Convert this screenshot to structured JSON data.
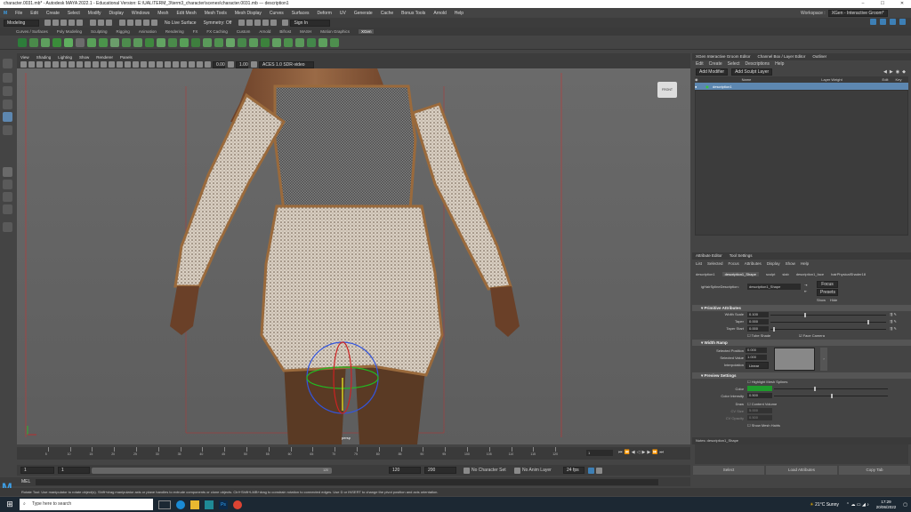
{
  "window": {
    "title": "character.0031.mb* - Autodesk MAYA 2022.1 - Educational Version: E:\\UAL\\TERM_3\\term3_character\\scenes\\character.0031.mb --- description1",
    "workspace_label": "Workspace :",
    "workspace_value": "XGen - Interactive Groom*"
  },
  "menus": [
    "File",
    "Edit",
    "Create",
    "Select",
    "Modify",
    "Display",
    "Windows",
    "Mesh",
    "Edit Mesh",
    "Mesh Tools",
    "Mesh Display",
    "Curves",
    "Surfaces",
    "Deform",
    "UV",
    "Generate",
    "Cache",
    "Bonus Tools",
    "Arnold",
    "Help"
  ],
  "status_line": {
    "mode": "Modeling",
    "live_surface": "No Live Surface",
    "symmetry": "Symmetry: Off",
    "sign_in": "Sign In"
  },
  "shelf_tabs": [
    "Curves / Surfaces",
    "Poly Modeling",
    "Sculpting",
    "Rigging",
    "Animation",
    "Rendering",
    "FX",
    "FX Caching",
    "Custom",
    "Arnold",
    "Bifrost",
    "MASH",
    "Motion Graphics",
    "XGen"
  ],
  "shelf_active": "XGen",
  "viewport": {
    "menus": [
      "View",
      "Shading",
      "Lighting",
      "Show",
      "Renderer",
      "Panels"
    ],
    "exposure": "0.00",
    "gamma": "1.00",
    "color_space": "ACES 1.0 SDR-video (sRGB)",
    "camera_label": "persp",
    "viewcube_label": "FRONT"
  },
  "timeline": {
    "ticks": [
      "5",
      "10",
      "15",
      "20",
      "25",
      "30",
      "35",
      "40",
      "45",
      "50",
      "55",
      "60",
      "65",
      "70",
      "75",
      "80",
      "85",
      "90",
      "95",
      "100",
      "105",
      "110",
      "115",
      "120"
    ],
    "current_frame": "1"
  },
  "range": {
    "start": "1",
    "inner_start": "1",
    "slider_value": "120",
    "inner_end": "120",
    "end": "200",
    "character_set": "No Character Set",
    "anim_layer": "No Anim Layer",
    "fps": "24 fps"
  },
  "mel": {
    "label": "MEL"
  },
  "help_line": "Rotate Tool: Use manipulator to rotate object(s). Shift+drag manipulator axis or plane handles to extrude components or clone objects. Ctrl+Shift+LMB+drag to constrain rotation to connected edges. Use D or INSERT to change the pivot position and axis orientation.",
  "xgen": {
    "tabs": [
      "XGen Interactive Groom Editor",
      "Channel Box / Layer Editor",
      "Outliner"
    ],
    "menus": [
      "Edit",
      "Create",
      "Select",
      "Descriptions",
      "Help"
    ],
    "buttons": [
      "Add Modifier",
      "Add Sculpt Layer"
    ],
    "columns": [
      "Name",
      "Layer Weight",
      "Edit",
      "Key"
    ],
    "rows": [
      {
        "name": "description1"
      }
    ]
  },
  "attr": {
    "tabs": [
      "Attribute Editor",
      "Tool Settings"
    ],
    "menus": [
      "List",
      "Selected",
      "Focus",
      "Attributes",
      "Display",
      "Show",
      "Help"
    ],
    "node_tabs": [
      "description1",
      "description1_Shape",
      "sculpt",
      "slab",
      "description1_face",
      "hairPhysicalShader18"
    ],
    "node_label": "igHairSplineDescription:",
    "node_value": "description1_Shape",
    "focus": "Focus",
    "presets": "Presets",
    "show": "Show",
    "hide": "Hide",
    "sections": {
      "primitive": "Primitive Attributes",
      "width_ramp": "Width Ramp",
      "preview": "Preview Settings"
    },
    "primitive": [
      {
        "label": "Width Scale",
        "value": "0.100",
        "frac": 0.3
      },
      {
        "label": "Taper",
        "value": "0.000",
        "frac": 0.85
      },
      {
        "label": "Taper Start",
        "value": "0.000",
        "frac": 0.02
      }
    ],
    "tube_shade": "Tube Shade",
    "face_camera": "Face Camera",
    "ramp": {
      "selected_position_label": "Selected Position",
      "selected_position": "0.000",
      "selected_value_label": "Selected Value",
      "selected_value": "1.000",
      "interpolation_label": "Interpolation",
      "interpolation": "Linear"
    },
    "preview": {
      "highlight": "Highlight Mesh Splines",
      "color_label": "Color",
      "color_value": "#1f9a2c",
      "color_intensity_label": "Color Intensity",
      "color_intensity": "0.500",
      "draw_label": "Draw",
      "content_lock": "Content Volume",
      "cv_size_label": "CV Size",
      "cv_size": "5.000",
      "cv_opacity_label": "CV Opacity",
      "cv_opacity": "0.500",
      "show_mesh": "Show Mesh Hairls"
    },
    "notes": "Notes: description1_Shape",
    "bottom_buttons": [
      "Select",
      "Load Attributes",
      "Copy Tab"
    ]
  },
  "taskbar": {
    "search": "Type here to search",
    "weather": "21°C  Sunny",
    "time": "17:29",
    "date": "20/06/2022"
  },
  "colors": {
    "selection": "#5d87b0",
    "accent_blue": "#4a8fc4",
    "xgen_green": "#1f9a2c"
  }
}
